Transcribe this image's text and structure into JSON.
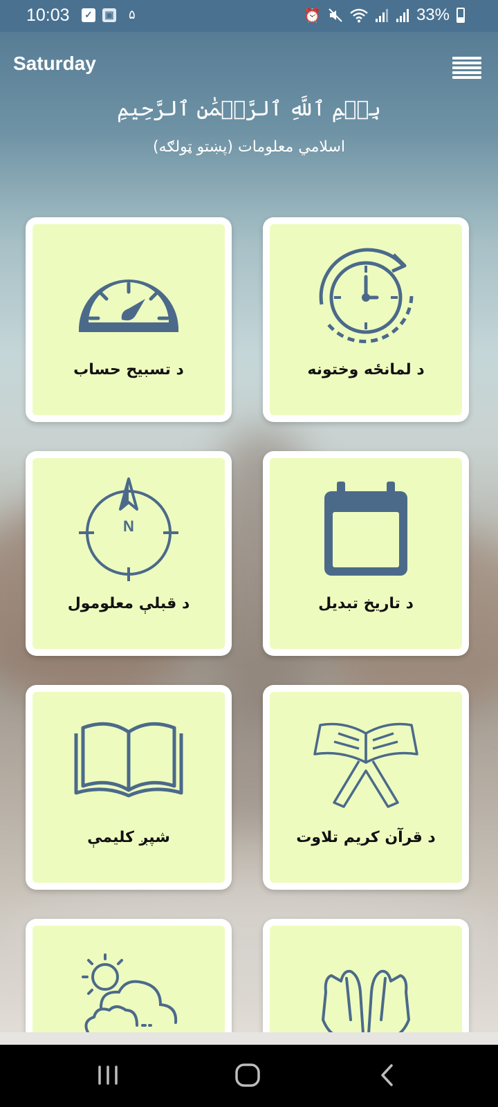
{
  "status_bar": {
    "time": "10:03",
    "left_digit": "۵",
    "battery": "33%",
    "icons": [
      "check-square-icon",
      "app-badge-icon",
      "alarm-icon",
      "mute-icon",
      "wifi-icon",
      "signal-icon",
      "signal-icon",
      "battery-icon"
    ]
  },
  "header": {
    "day": "Saturday",
    "bismillah": "بِسۡمِ ٱللَّهِ ٱلرَّحۡمَٰنِ ٱلرَّحِيمِ",
    "subtitle": "اسلامي معلومات (پښتو ټولګه)"
  },
  "cards": [
    {
      "label": "د تسبیح حساب",
      "icon": "speedometer-icon"
    },
    {
      "label": "د لمانځه وختونه",
      "icon": "clock-refresh-icon"
    },
    {
      "label": "د قبلې معلومول",
      "icon": "compass-icon"
    },
    {
      "label": "د تاریخ تبدیل",
      "icon": "calendar-icon"
    },
    {
      "label": "شپږ کلیمې",
      "icon": "open-book-icon"
    },
    {
      "label": "د قرآن کریم تلاوت",
      "icon": "quran-stand-icon"
    },
    {
      "label": "",
      "icon": "weather-icon"
    },
    {
      "label": "",
      "icon": "praying-hands-icon"
    }
  ],
  "colors": {
    "status_bar": "#4a7290",
    "card_fill": "#eefbbf",
    "icon": "#4b6a8a",
    "card_border": "#ffffff"
  },
  "nav_bar": {
    "icons": [
      "recent-apps-icon",
      "home-icon",
      "back-icon"
    ]
  }
}
